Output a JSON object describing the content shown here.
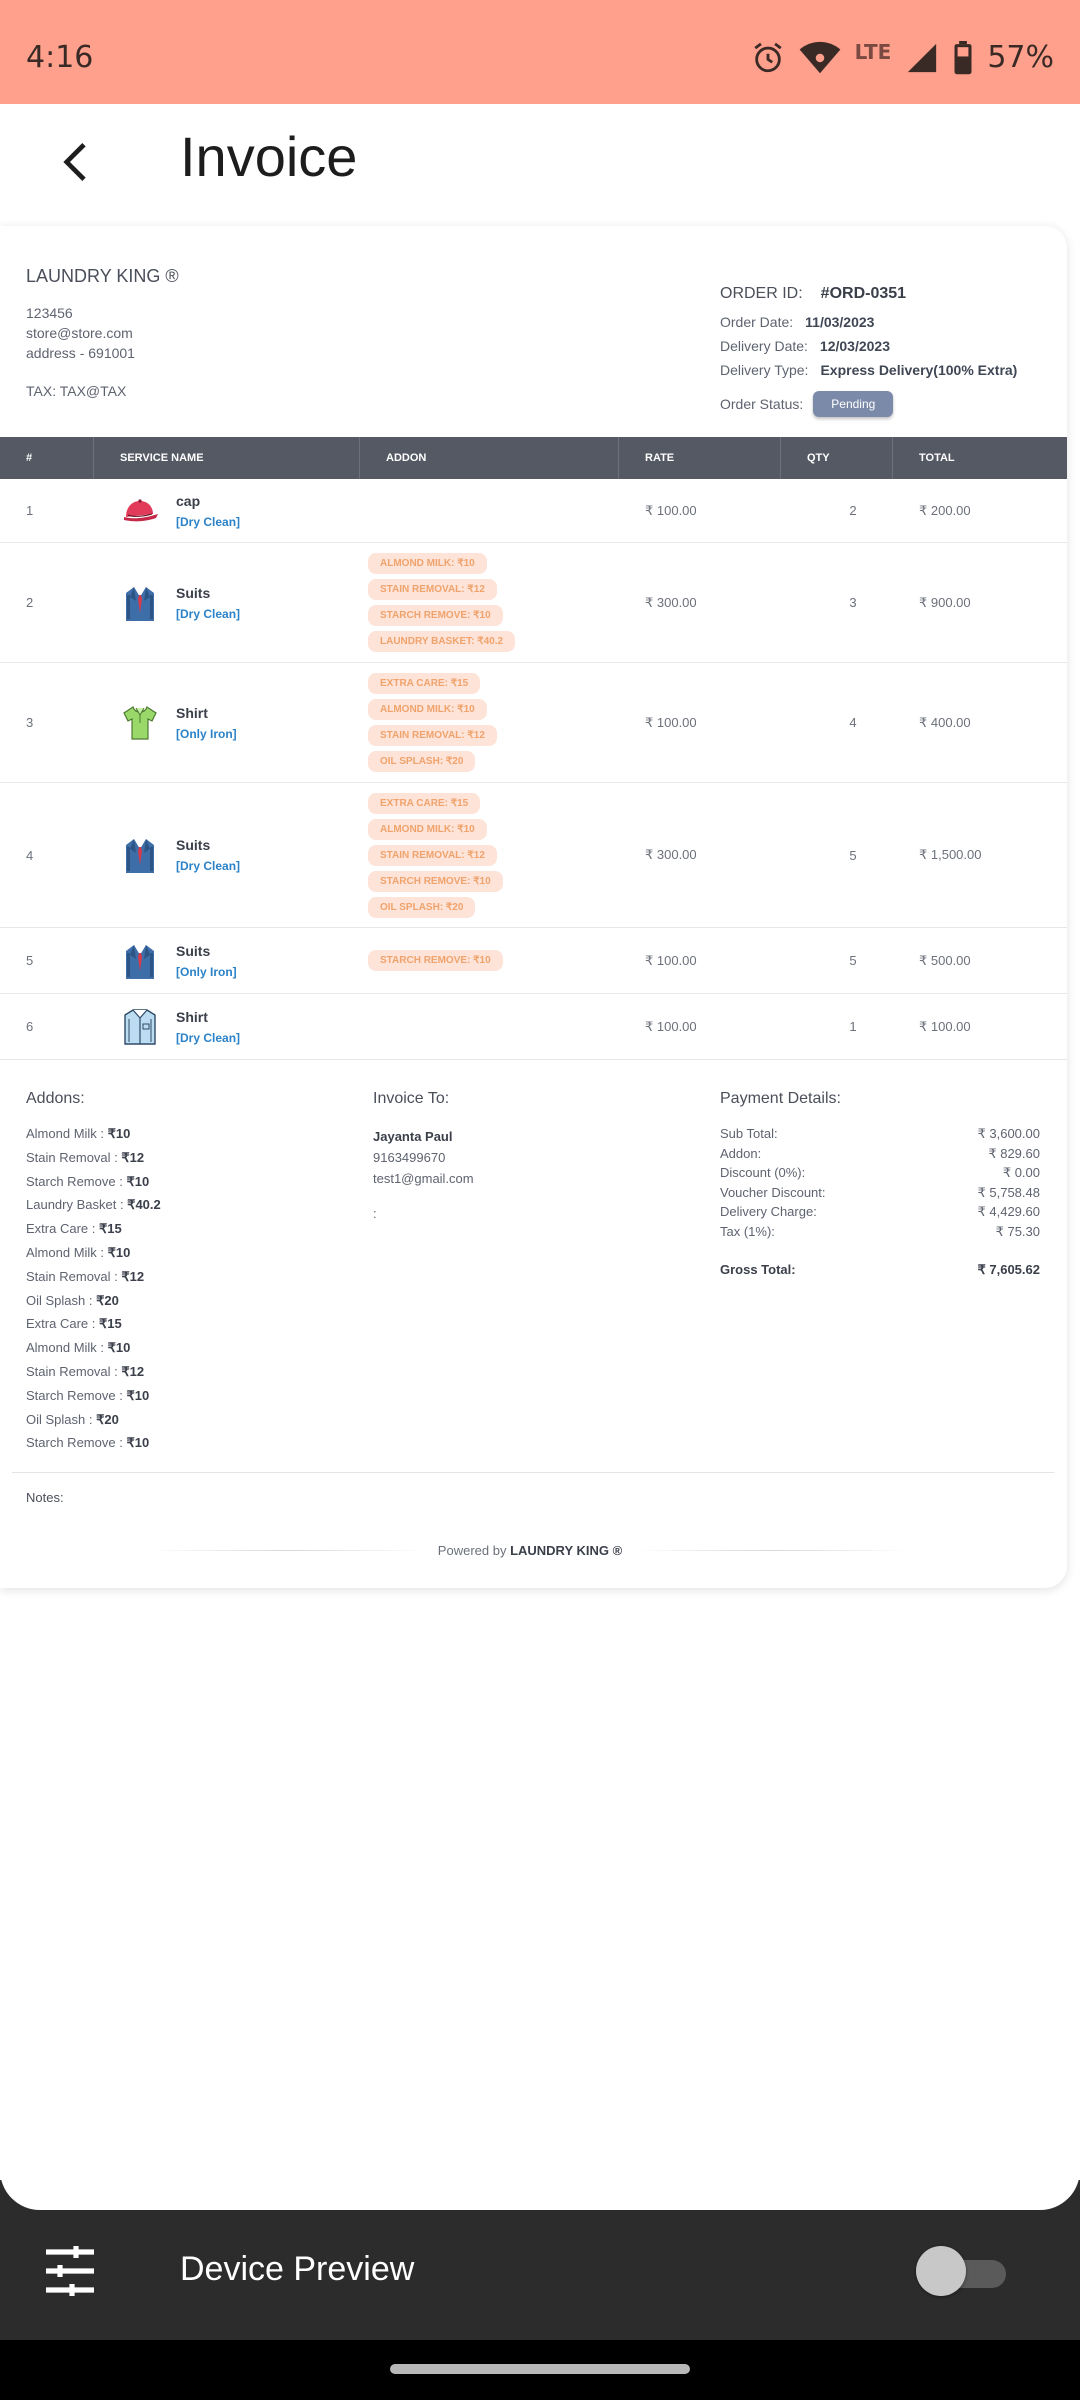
{
  "status_bar": {
    "time": "4:16",
    "network": "LTE",
    "battery": "57%"
  },
  "app_bar": {
    "title": "Invoice"
  },
  "store": {
    "name": "LAUNDRY KING ®",
    "lines": [
      "123456",
      "store@store.com",
      "address - 691001"
    ],
    "tax": "TAX: TAX@TAX"
  },
  "order": {
    "id_label": "ORDER ID:",
    "id_value": "#ORD-0351",
    "date_label": "Order Date:",
    "date_value": "11/03/2023",
    "delivery_date_label": "Delivery Date:",
    "delivery_date_value": "12/03/2023",
    "delivery_type_label": "Delivery Type:",
    "delivery_type_value": "Express Delivery(100% Extra)",
    "status_label": "Order Status:",
    "status_value": "Pending"
  },
  "table": {
    "headers": [
      "#",
      "SERVICE NAME",
      "ADDON",
      "RATE",
      "QTY",
      "TOTAL"
    ],
    "rows": [
      {
        "no": "1",
        "name": "cap",
        "service": "[Dry Clean]",
        "icon": "cap-icon",
        "addons": [],
        "rate": "₹ 100.00",
        "qty": "2",
        "total": "₹ 200.00"
      },
      {
        "no": "2",
        "name": "Suits",
        "service": "[Dry Clean]",
        "icon": "suit-icon",
        "addons": [
          "ALMOND MILK: ₹10",
          "STAIN REMOVAL: ₹12",
          "STARCH REMOVE: ₹10",
          "LAUNDRY BASKET: ₹40.2"
        ],
        "rate": "₹ 300.00",
        "qty": "3",
        "total": "₹ 900.00"
      },
      {
        "no": "3",
        "name": "Shirt",
        "service": "[Only Iron]",
        "icon": "polo-shirt-icon",
        "addons": [
          "EXTRA CARE: ₹15",
          "ALMOND MILK: ₹10",
          "STAIN REMOVAL: ₹12",
          "OIL SPLASH: ₹20"
        ],
        "rate": "₹ 100.00",
        "qty": "4",
        "total": "₹ 400.00"
      },
      {
        "no": "4",
        "name": "Suits",
        "service": "[Dry Clean]",
        "icon": "suit-icon",
        "addons": [
          "EXTRA CARE: ₹15",
          "ALMOND MILK: ₹10",
          "STAIN REMOVAL: ₹12",
          "STARCH REMOVE: ₹10",
          "OIL SPLASH: ₹20"
        ],
        "rate": "₹ 300.00",
        "qty": "5",
        "total": "₹ 1,500.00"
      },
      {
        "no": "5",
        "name": "Suits",
        "service": "[Only Iron]",
        "icon": "suit-icon",
        "addons": [
          "STARCH REMOVE: ₹10"
        ],
        "rate": "₹ 100.00",
        "qty": "5",
        "total": "₹ 500.00"
      },
      {
        "no": "6",
        "name": "Shirt",
        "service": "[Dry Clean]",
        "icon": "dress-shirt-icon",
        "addons": [],
        "rate": "₹ 100.00",
        "qty": "1",
        "total": "₹ 100.00"
      }
    ]
  },
  "addons_section": {
    "title": "Addons:",
    "items": [
      {
        "name": "Almond Milk : ",
        "price": "₹10"
      },
      {
        "name": "Stain Removal : ",
        "price": "₹12"
      },
      {
        "name": "Starch Remove : ",
        "price": "₹10"
      },
      {
        "name": "Laundry Basket : ",
        "price": "₹40.2"
      },
      {
        "name": "Extra Care : ",
        "price": "₹15"
      },
      {
        "name": "Almond Milk : ",
        "price": "₹10"
      },
      {
        "name": "Stain Removal : ",
        "price": "₹12"
      },
      {
        "name": "Oil Splash : ",
        "price": "₹20"
      },
      {
        "name": "Extra Care : ",
        "price": "₹15"
      },
      {
        "name": "Almond Milk : ",
        "price": "₹10"
      },
      {
        "name": "Stain Removal : ",
        "price": "₹12"
      },
      {
        "name": "Starch Remove : ",
        "price": "₹10"
      },
      {
        "name": "Oil Splash : ",
        "price": "₹20"
      },
      {
        "name": "Starch Remove : ",
        "price": "₹10"
      }
    ]
  },
  "invoice_to": {
    "title": "Invoice To:",
    "name": "Jayanta Paul",
    "phone": "9163499670",
    "email": "test1@gmail.com",
    "address": ":"
  },
  "payment": {
    "title": "Payment Details:",
    "rows": [
      {
        "label": "Sub Total:",
        "value": "₹ 3,600.00"
      },
      {
        "label": "Addon:",
        "value": "₹ 829.60"
      },
      {
        "label": "Discount (0%):",
        "value": "₹ 0.00"
      },
      {
        "label": "Voucher Discount:",
        "value": "₹ 5,758.48"
      },
      {
        "label": "Delivery Charge:",
        "value": "₹ 4,429.60"
      },
      {
        "label": "Tax (1%):",
        "value": "₹ 75.30"
      }
    ],
    "gross_label": "Gross Total:",
    "gross_value": "₹ 7,605.62"
  },
  "notes_label": "Notes:",
  "powered": {
    "prefix": "Powered by ",
    "brand": "LAUNDRY KING ®"
  },
  "device_preview": {
    "label": "Device Preview",
    "enabled": false
  },
  "colors": {
    "status_bar": "#ffa08c",
    "table_header": "#545963",
    "addon_pill_bg": "#fde3d8",
    "addon_pill_text": "#f0a36c",
    "service_link": "#2b82c8",
    "status_badge": "#7a8aa8"
  }
}
